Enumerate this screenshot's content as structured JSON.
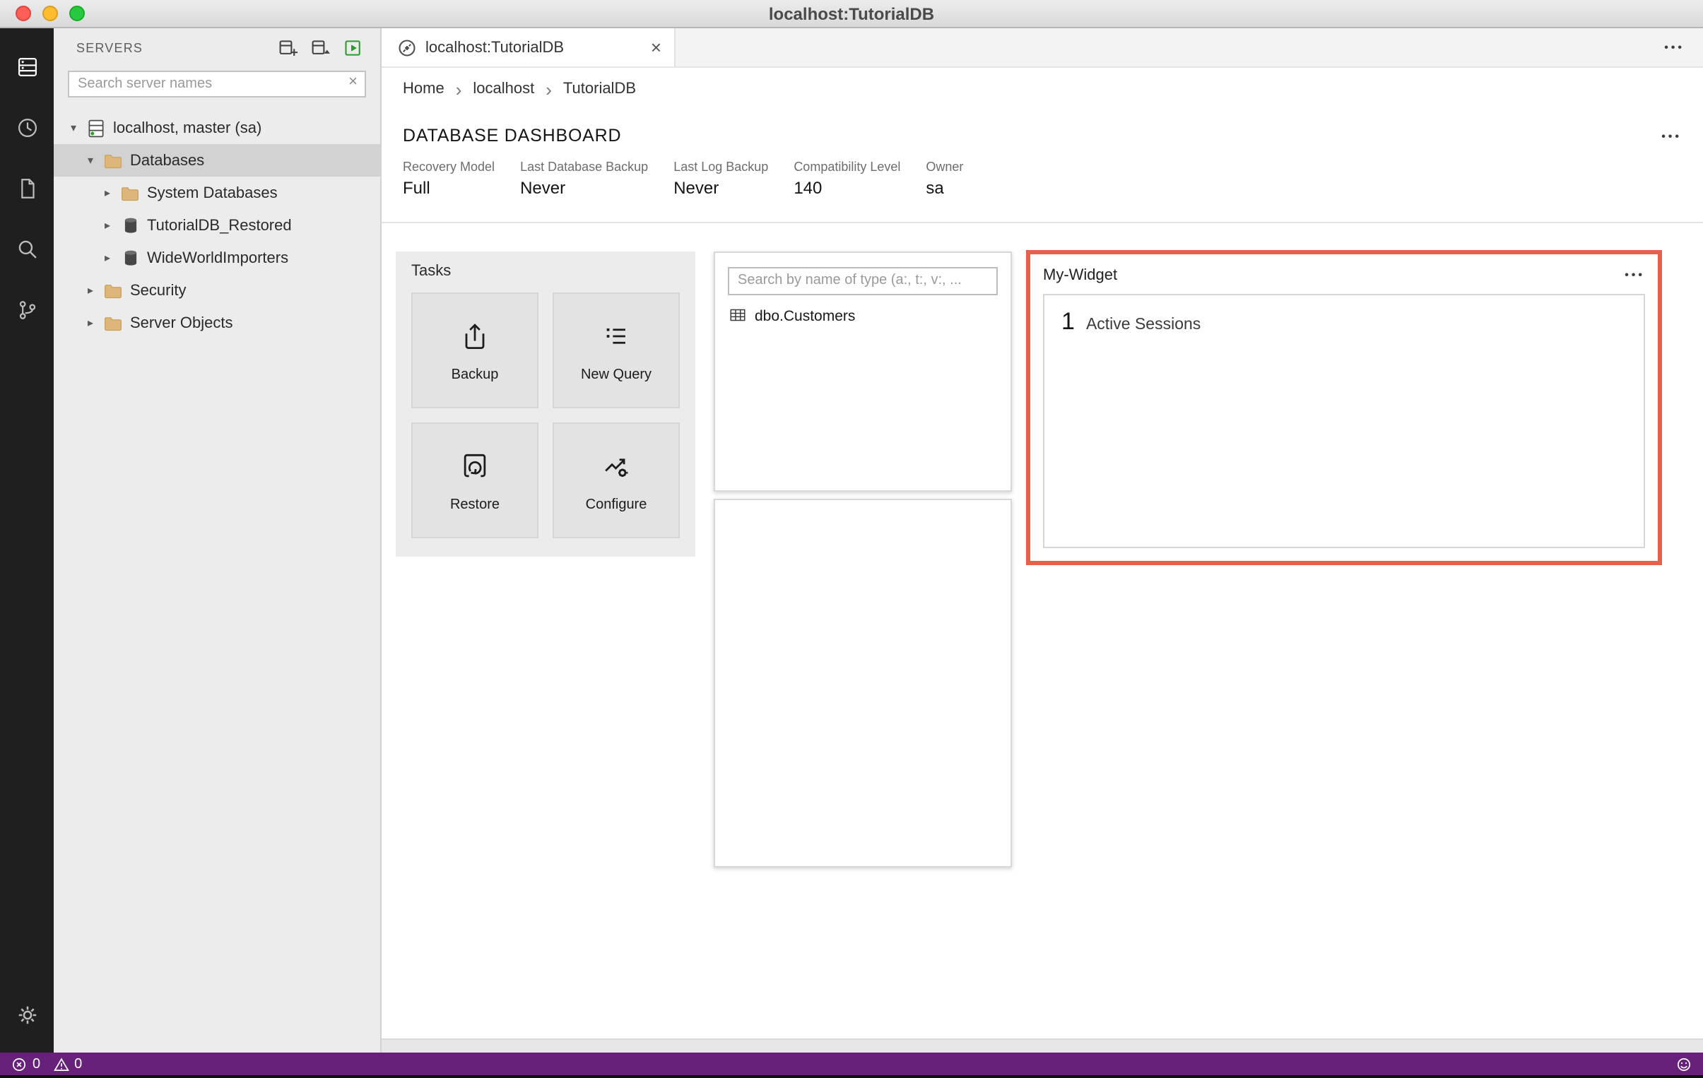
{
  "titlebar": {
    "title": "localhost:TutorialDB"
  },
  "activity_bar": {
    "items": [
      "connections-icon",
      "task-history-icon",
      "file-icon",
      "search-icon",
      "source-control-icon"
    ],
    "bottom": [
      "settings-gear-icon"
    ]
  },
  "sidebar": {
    "title": "SERVERS",
    "actions": [
      "new-connection-icon",
      "new-server-group-icon",
      "active-connections-icon"
    ],
    "search": {
      "placeholder": "Search server names"
    },
    "tree": [
      {
        "label": "localhost, master (sa)",
        "icon": "server-icon",
        "state": "expanded"
      },
      {
        "label": "Databases",
        "icon": "folder-icon",
        "state": "expanded",
        "selected": true
      },
      {
        "label": "System Databases",
        "icon": "folder-icon",
        "state": "collapsed"
      },
      {
        "label": "TutorialDB_Restored",
        "icon": "database-icon",
        "state": "collapsed"
      },
      {
        "label": "WideWorldImporters",
        "icon": "database-icon",
        "state": "collapsed"
      },
      {
        "label": "Security",
        "icon": "folder-icon",
        "state": "collapsed"
      },
      {
        "label": "Server Objects",
        "icon": "folder-icon",
        "state": "collapsed"
      }
    ]
  },
  "editor": {
    "tab": {
      "title": "localhost:TutorialDB",
      "icon": "connection-icon"
    },
    "breadcrumb": {
      "items": [
        "Home",
        "localhost",
        "TutorialDB"
      ]
    },
    "dashboard": {
      "title": "DATABASE DASHBOARD",
      "properties": [
        {
          "label": "Recovery Model",
          "value": "Full"
        },
        {
          "label": "Last Database Backup",
          "value": "Never"
        },
        {
          "label": "Last Log Backup",
          "value": "Never"
        },
        {
          "label": "Compatibility Level",
          "value": "140"
        },
        {
          "label": "Owner",
          "value": "sa"
        }
      ],
      "tasks": {
        "title": "Tasks",
        "buttons": [
          {
            "label": "Backup",
            "icon": "backup-icon"
          },
          {
            "label": "New Query",
            "icon": "new-query-icon"
          },
          {
            "label": "Restore",
            "icon": "restore-icon"
          },
          {
            "label": "Configure",
            "icon": "configure-icon"
          }
        ]
      },
      "explorer": {
        "search": {
          "placeholder": "Search by name of type (a:, t:, v:, ..."
        },
        "items": [
          {
            "label": "dbo.Customers",
            "icon": "table-icon"
          }
        ]
      },
      "my_widget": {
        "title": "My-Widget",
        "count": "1",
        "label": "Active Sessions"
      }
    }
  },
  "status_bar": {
    "errors": "0",
    "warnings": "0",
    "right": [
      "feedback-smiley-icon"
    ]
  },
  "icons": {
    "ellipsis": "•••",
    "close": "×",
    "clear": "×",
    "breadcrumb_separator": "›",
    "twisty_expanded": "▾",
    "twisty_collapsed": "▸"
  },
  "colors": {
    "highlight_border": "#e8604c",
    "status_bar": "#68217a",
    "folder_icon": "#dcb67a",
    "traffic_lights": [
      "#ff5f57",
      "#febc2e",
      "#28c840"
    ]
  }
}
